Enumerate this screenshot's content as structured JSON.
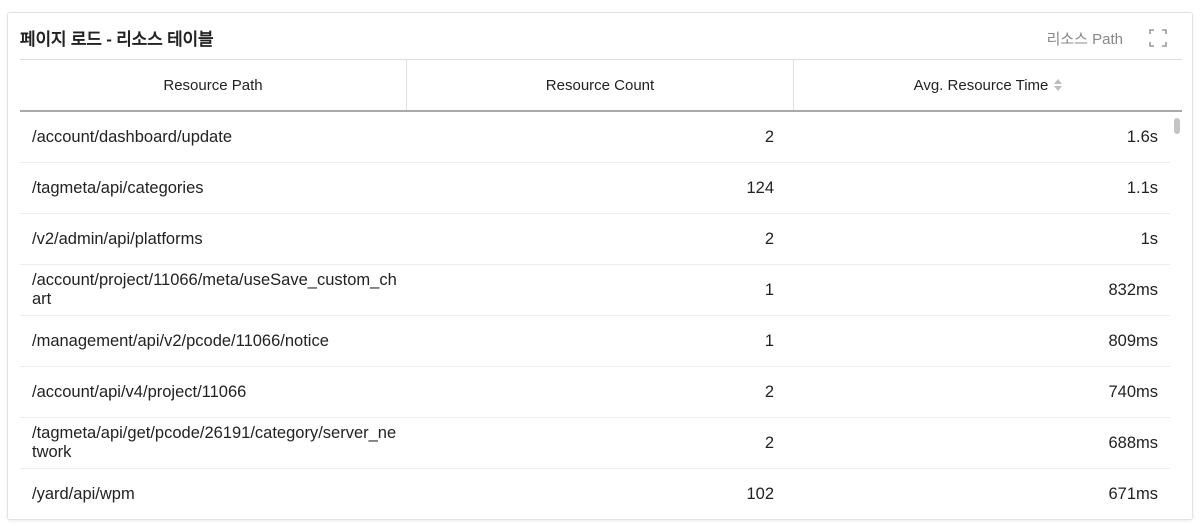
{
  "card": {
    "title": "페이지 로드 - 리소스 테이블",
    "header_link": "리소스 Path",
    "expand_icon": "expand-icon"
  },
  "table": {
    "columns": [
      "Resource Path",
      "Resource Count",
      "Avg. Resource Time"
    ],
    "sort_icon": "sort-icon",
    "rows": [
      {
        "path": "/account/dashboard/update",
        "count": "2",
        "time": "1.6s"
      },
      {
        "path": "/tagmeta/api/categories",
        "count": "124",
        "time": "1.1s"
      },
      {
        "path": "/v2/admin/api/platforms",
        "count": "2",
        "time": "1s"
      },
      {
        "path": "/account/project/11066/meta/useSave_custom_chart",
        "count": "1",
        "time": "832ms"
      },
      {
        "path": "/management/api/v2/pcode/11066/notice",
        "count": "1",
        "time": "809ms"
      },
      {
        "path": "/account/api/v4/project/11066",
        "count": "2",
        "time": "740ms"
      },
      {
        "path": "/tagmeta/api/get/pcode/26191/category/server_network",
        "count": "2",
        "time": "688ms"
      },
      {
        "path": "/yard/api/wpm",
        "count": "102",
        "time": "671ms"
      }
    ]
  },
  "colors": {
    "header_border": "#a9a9a9",
    "row_border": "#ededed",
    "muted_text": "#888888"
  }
}
